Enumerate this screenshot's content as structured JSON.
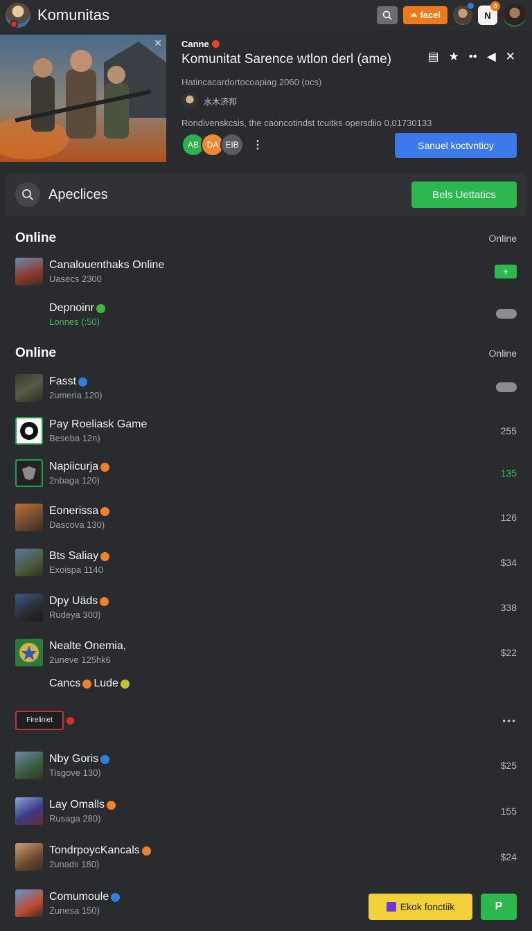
{
  "topbar": {
    "title": "Komunitas",
    "search_btn_icon": "search-icon",
    "action_label": "⏶ facel",
    "badge_count": "0",
    "badge_letter": "N"
  },
  "hero": {
    "game_label": "Canne",
    "title": "Komunitat Sarence wtlon derl (ame)",
    "subtitle": "Hatincacardortocoapiag 2060 (ocs)",
    "author": "水木济邦",
    "description": "Rondivenskcsis, the caoncotindst tcuitks opersdiio  0,01730133",
    "chips": [
      "AB",
      "DA",
      "ΕΙΒ"
    ],
    "more": "⋮",
    "cta": "Sanuel koctvntioy"
  },
  "search": {
    "title": "Apeclices",
    "button": "Bels Uettatics"
  },
  "section1": {
    "heading": "Online",
    "right": "Online",
    "rows": [
      {
        "name": "Canalouenthaks Online",
        "sub": "Uasecs 2300"
      },
      {
        "name": "Depnoinr",
        "sub": "Lonnes (:50)"
      }
    ]
  },
  "section2": {
    "heading": "Online",
    "right": "Online",
    "rows": [
      {
        "name": "Fasst",
        "sub": "2umeria 120)",
        "value": ""
      },
      {
        "name": "Pay Roeliask Game",
        "sub": "Beseba 12n)",
        "value": "255"
      },
      {
        "name": "Napiicurja",
        "sub": "2nbaga 120)",
        "value": "135"
      },
      {
        "name": "Eonerissa",
        "sub": "Dascova 130)",
        "value": "126"
      },
      {
        "name": "Bts Saliay",
        "sub": "Exoispa 1140",
        "value": "$34"
      },
      {
        "name": "Dpy Uäds",
        "sub": "Rudeya 300)",
        "value": "338"
      },
      {
        "name": "Nealte Onemia,",
        "sub": "2uneve 125hk6",
        "value": "$22"
      },
      {
        "name": "Cancs",
        "name2": "Lude",
        "sub": "",
        "value": ""
      },
      {
        "name": "",
        "logo_text": "Fireliniet",
        "sub": "",
        "value": "•••"
      },
      {
        "name": "Nby Goris",
        "sub": "Tisgove 130)",
        "value": "$25"
      },
      {
        "name": "Lay Omalls",
        "sub": "Rusaga 280)",
        "value": "155"
      },
      {
        "name": "TondrpoycKancals",
        "sub": "2unads 180)",
        "value": "$24"
      },
      {
        "name": "Comumoule",
        "sub": "Zunesa 150)",
        "value": ""
      }
    ]
  },
  "footer": {
    "yellow_btn": "Ekok fonctiik",
    "green_btn": "P"
  },
  "colors": {
    "background": "#2a2b2e",
    "accent_green": "#2db84d",
    "accent_blue": "#3b7ae8",
    "accent_orange": "#f07a1a",
    "accent_yellow": "#f3d13b"
  }
}
